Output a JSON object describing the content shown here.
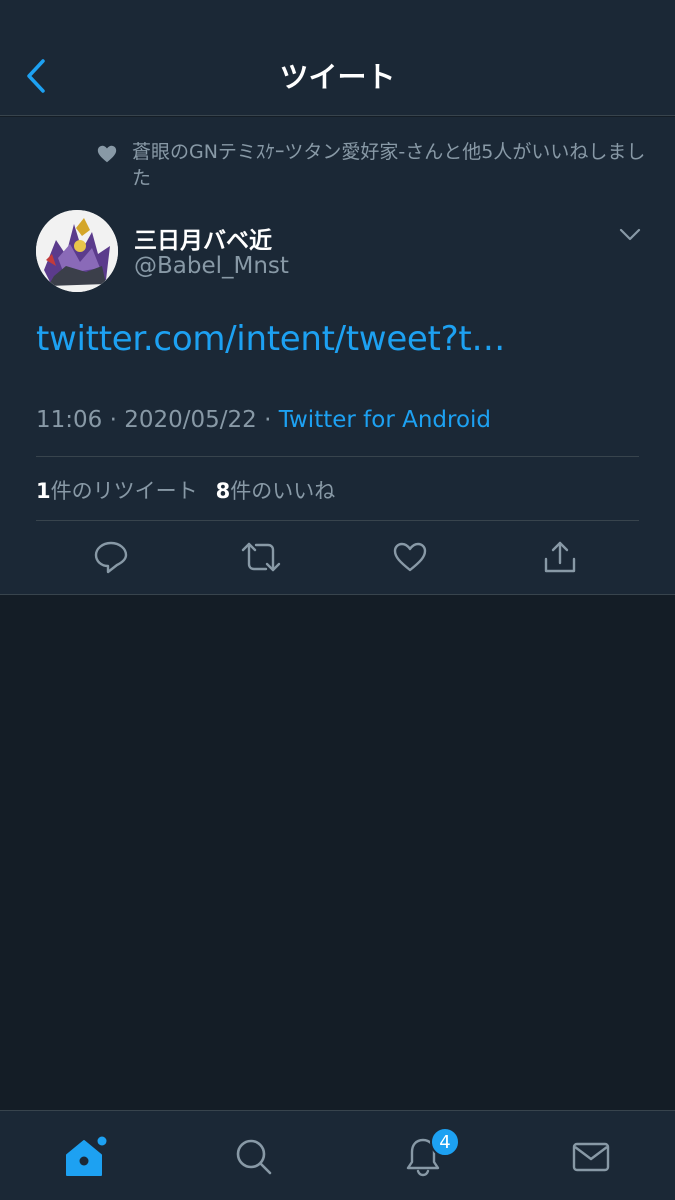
{
  "header": {
    "title": "ツイート",
    "back_icon": "chevron-left-icon"
  },
  "colors": {
    "background": "#141d26",
    "surface": "#1b2836",
    "accent": "#1da1f2",
    "secondary_text": "#8899a6",
    "divider": "#38444d"
  },
  "tweet": {
    "social_context": "蒼眼のGNテミｽｹｰツタン愛好家-さんと他5人がいいねしました",
    "display_name": "三日月バベ近",
    "handle": "@Babel_Mnst",
    "link_text": "twitter.com/intent/tweet?t…",
    "time": "11:06",
    "date": "2020/05/22",
    "separator": "·",
    "source": "Twitter for Android",
    "retweet_count": "1",
    "retweet_label": "件のリツイート",
    "like_count": "8",
    "like_label": "件のいいね",
    "actions": [
      "reply-icon",
      "retweet-icon",
      "like-icon",
      "share-icon"
    ]
  },
  "tabbar": {
    "tabs": [
      "home-icon",
      "search-icon",
      "notifications-icon",
      "messages-icon"
    ],
    "notification_badge": "4"
  }
}
